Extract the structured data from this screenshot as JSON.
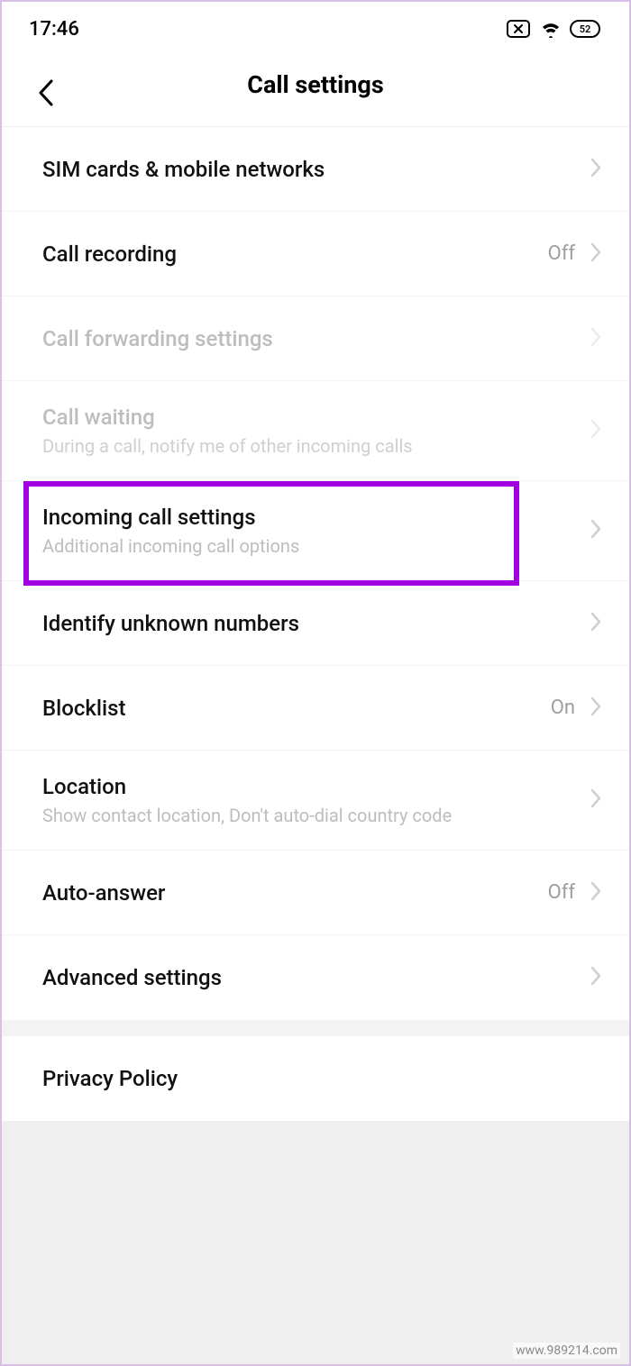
{
  "statusbar": {
    "time": "17:46",
    "battery": "52"
  },
  "header": {
    "title": "Call settings"
  },
  "items": {
    "sim": {
      "label": "SIM cards & mobile networks"
    },
    "recording": {
      "label": "Call recording",
      "value": "Off"
    },
    "forwarding": {
      "label": "Call forwarding settings"
    },
    "waiting": {
      "label": "Call waiting",
      "sub": "During a call, notify me of other incoming calls"
    },
    "incoming": {
      "label": "Incoming call settings",
      "sub": "Additional incoming call options"
    },
    "identify": {
      "label": "Identify unknown numbers"
    },
    "blocklist": {
      "label": "Blocklist",
      "value": "On"
    },
    "location": {
      "label": "Location",
      "sub": "Show contact location, Don't auto-dial country code"
    },
    "autoanswer": {
      "label": "Auto-answer",
      "value": "Off"
    },
    "advanced": {
      "label": "Advanced settings"
    },
    "privacy": {
      "label": "Privacy Policy"
    }
  },
  "watermark": "www.989214.com"
}
